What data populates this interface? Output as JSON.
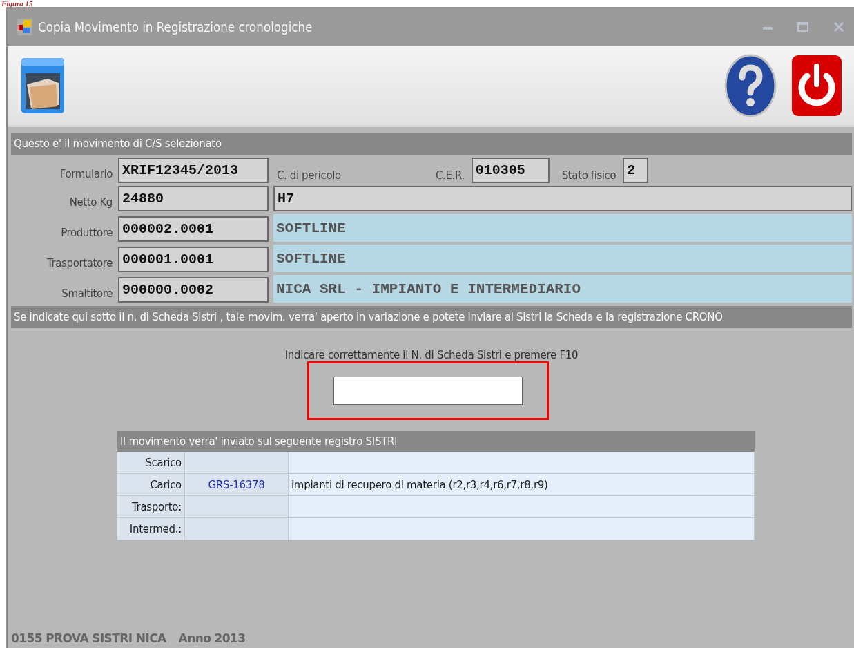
{
  "caption": "Figura 15",
  "window": {
    "title": "Copia Movimento in Registrazione cronologiche"
  },
  "section_header": "Questo e' il movimento di C/S selezionato",
  "form": {
    "formulario": {
      "label": "Formulario",
      "value": "XRIF12345/2013"
    },
    "pericolo": {
      "label": "C. di pericolo",
      "value": "H7"
    },
    "cer": {
      "label": "C.E.R.",
      "value": "010305"
    },
    "stato_fisico": {
      "label": "Stato fisico",
      "value": "2"
    },
    "netto": {
      "label": "Netto Kg",
      "value": "24880"
    },
    "subjects": [
      {
        "label": "Produttore",
        "code": "000002.0001",
        "name": "SOFTLINE"
      },
      {
        "label": "Trasportatore",
        "code": "000001.0001",
        "name": "SOFTLINE"
      },
      {
        "label": "Smaltitore",
        "code": "900000.0002",
        "name": "NICA SRL - IMPIANTO E INTERMEDIARIO"
      }
    ]
  },
  "info_bar": "Se indicate qui sotto il n. di Scheda Sistri , tale movim. verra' aperto in variazione e potete inviare al Sistri la Scheda e la registrazione CRONO",
  "prompt": "Indicare correttamente il N. di Scheda Sistri e premere F10",
  "registry": {
    "title": "Il movimento verra' inviato sul seguente registro SISTRI",
    "rows": [
      {
        "label": "Scarico"
      },
      {
        "label": "Carico",
        "code": "GRS-16378",
        "description": "impianti di recupero di materia (r2,r3,r4,r6,r7,r8,r9)"
      },
      {
        "label": "Trasporto:"
      },
      {
        "label": "Intermed.:"
      }
    ]
  },
  "status": {
    "company": "0155 PROVA SISTRI NICA",
    "year": "Anno 2013"
  }
}
